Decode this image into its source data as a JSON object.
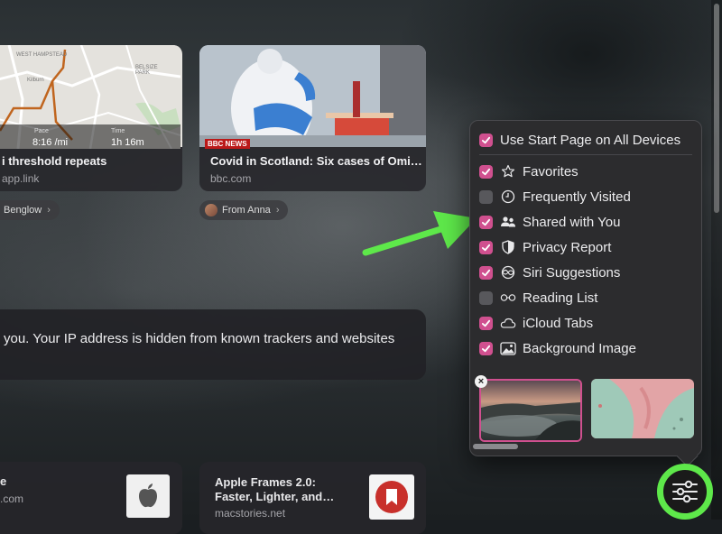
{
  "cards": [
    {
      "title": "i threshold repeats",
      "domain": "app.link",
      "pill": "Benglow",
      "map_labels": {
        "place1": "WEST HAMPSTEAD",
        "place2": "BELSIZE PARK",
        "place3": "Kilburn",
        "route1": "8:16 /mi",
        "route2": "Pace",
        "time": "1h 16m",
        "time_label": "Time"
      }
    },
    {
      "title": "Covid in Scotland: Six cases of Omi…",
      "domain": "bbc.com",
      "pill": "From Anna",
      "badge": "BBC NEWS"
    }
  ],
  "privacy_text": "you. Your IP address is hidden from known trackers and websites",
  "reading_cards": [
    {
      "title": "e",
      "domain": ".com"
    },
    {
      "title_line1": "Apple Frames 2.0:",
      "title_line2": "Faster, Lighter, and…",
      "domain": "macstories.net"
    }
  ],
  "popover": {
    "top_option": {
      "label": "Use Start Page on All Devices",
      "checked": true
    },
    "options": [
      {
        "label": "Favorites",
        "checked": true,
        "icon": "star-icon"
      },
      {
        "label": "Frequently Visited",
        "checked": false,
        "icon": "clock-icon"
      },
      {
        "label": "Shared with You",
        "checked": true,
        "icon": "people-icon"
      },
      {
        "label": "Privacy Report",
        "checked": true,
        "icon": "shield-icon"
      },
      {
        "label": "Siri Suggestions",
        "checked": true,
        "icon": "siri-icon"
      },
      {
        "label": "Reading List",
        "checked": false,
        "icon": "glasses-icon"
      },
      {
        "label": "iCloud Tabs",
        "checked": true,
        "icon": "cloud-icon"
      },
      {
        "label": "Background Image",
        "checked": true,
        "icon": "photo-icon"
      }
    ]
  },
  "colors": {
    "checkbox_on": "#d0508f",
    "highlight_green": "#5ee84a"
  }
}
